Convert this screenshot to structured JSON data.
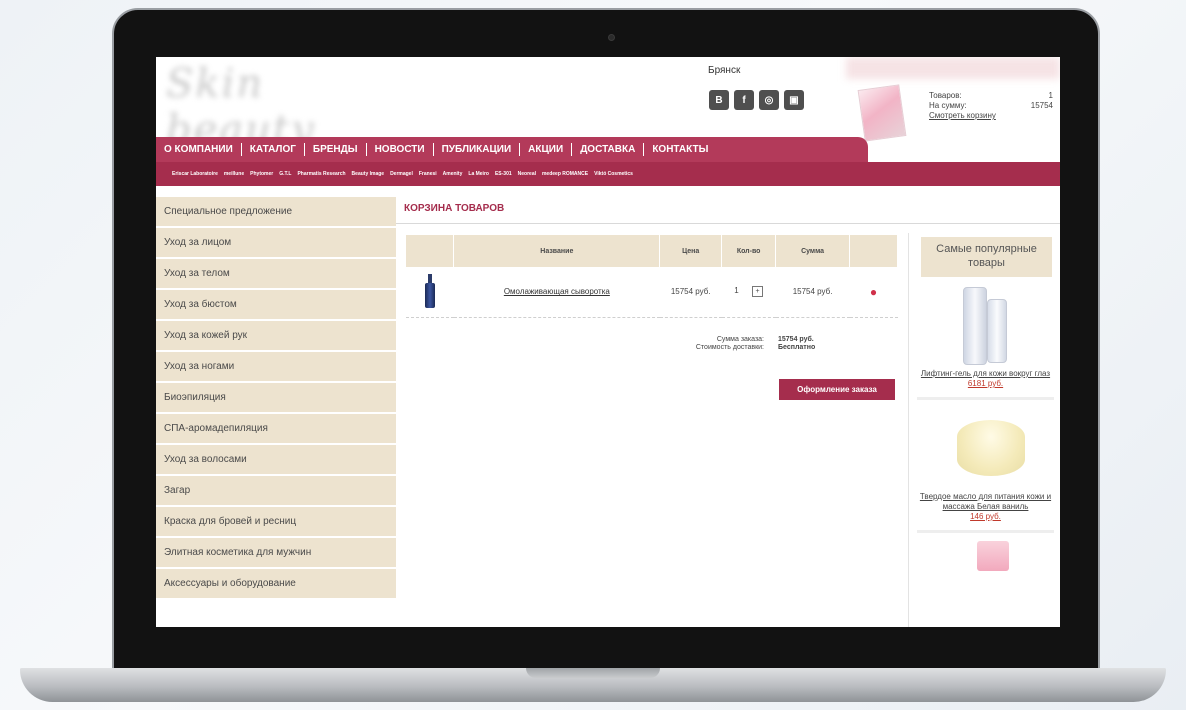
{
  "header": {
    "city": "Брянск",
    "social_icons": [
      "В",
      "f",
      "◎",
      "▣"
    ],
    "cart": {
      "items_label": "Товаров:",
      "items_value": "1",
      "sum_label": "На сумму:",
      "sum_value": "15754",
      "view_link": "Смотреть корзину"
    }
  },
  "nav": [
    "О КОМПАНИИ",
    "КАТАЛОГ",
    "БРЕНДЫ",
    "НОВОСТИ",
    "ПУБЛИКАЦИИ",
    "АКЦИИ",
    "ДОСТАВКА",
    "КОНТАКТЫ"
  ],
  "brands": [
    "Eriscar Laboratoire",
    "meillune",
    "Phytomer",
    "G.T.L",
    "Pharmatis Research",
    "Beauty Image",
    "Dermagel",
    "Franesi",
    "Amenity",
    "La Meiro",
    "ES-301",
    "Neoreal",
    "medeep ROMANCE",
    "Viktó Cosmetics"
  ],
  "sidebar": [
    "Специальное предложение",
    "Уход за лицом",
    "Уход за телом",
    "Уход за бюстом",
    "Уход за кожей рук",
    "Уход за ногами",
    "Биоэпиляция",
    "СПА-аромадепиляция",
    "Уход за волосами",
    "Загар",
    "Краска для бровей и ресниц",
    "Элитная косметика для мужчин",
    "Аксессуары и оборудование"
  ],
  "cart_page": {
    "title": "КОРЗИНА ТОВАРОВ",
    "columns": [
      "Название",
      "Цена",
      "Кол-во",
      "Сумма"
    ],
    "item": {
      "name": "Омолаживающая сыворотка",
      "price": "15754 руб.",
      "qty": "1",
      "qty_control": "+",
      "sum": "15754 руб.",
      "remove": "●"
    },
    "order_sum_label": "Сумма заказа:",
    "order_sum_value": "15754 руб.",
    "delivery_label": "Стоимость доставки:",
    "delivery_value": "Бесплатно",
    "checkout": "Оформление заказа"
  },
  "popular": {
    "title": "Самые популярные товары",
    "items": [
      {
        "name": "Лифтинг-гель для кожи вокруг глаз",
        "price": "6181 руб."
      },
      {
        "name": "Твердое масло для питания кожи и массажа Белая ваниль",
        "price": "146 руб."
      }
    ]
  }
}
